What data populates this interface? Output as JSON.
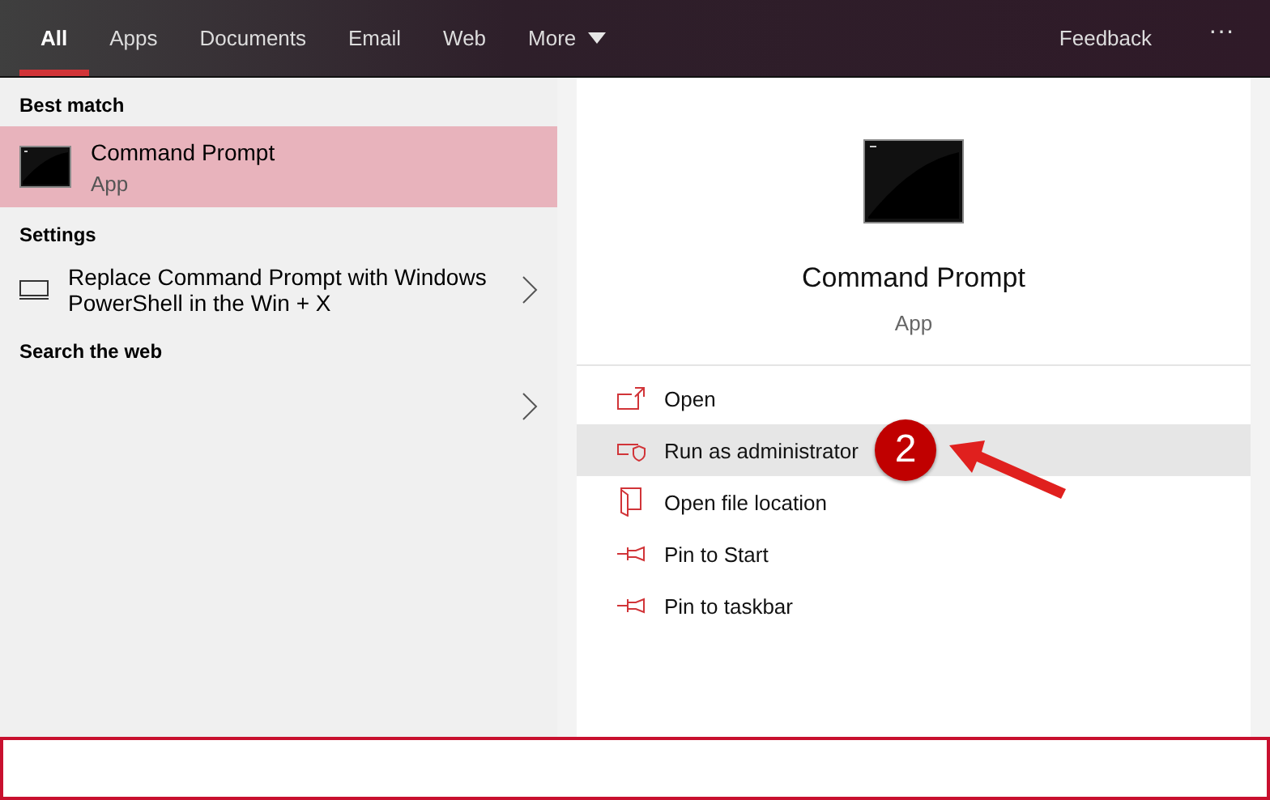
{
  "tabs": [
    {
      "label": "All",
      "selected": true
    },
    {
      "label": "Apps",
      "selected": false
    },
    {
      "label": "Documents",
      "selected": false
    },
    {
      "label": "Email",
      "selected": false
    },
    {
      "label": "Web",
      "selected": false
    }
  ],
  "more": {
    "label": "More"
  },
  "feedback": "Feedback",
  "overflow": "···",
  "results": [
    {
      "heading": "Best match",
      "items": [
        {
          "kind": "app",
          "title": "Command Prompt",
          "subtitle": "App",
          "selected": true
        }
      ]
    },
    {
      "heading": "Settings",
      "items": [
        {
          "kind": "setting",
          "title": "Replace Command Prompt with Windows PowerShell in the Win + X",
          "selected": false
        }
      ]
    },
    {
      "heading": "Search the web",
      "items": [
        {
          "kind": "web",
          "selected": false
        }
      ]
    }
  ],
  "detail": {
    "title": "Command Prompt",
    "subtitle": "App"
  },
  "actions": [
    {
      "kind": "open",
      "label": "Open",
      "selected": false
    },
    {
      "kind": "admin",
      "label": "Run as administrator",
      "selected": true
    },
    {
      "kind": "folder",
      "label": "Open file location",
      "selected": false
    },
    {
      "kind": "pin",
      "label": "Pin to Start",
      "selected": false
    },
    {
      "kind": "pin",
      "label": "Pin to taskbar",
      "selected": false
    }
  ],
  "callout": {
    "label": "2"
  },
  "search": {
    "focused": true
  }
}
